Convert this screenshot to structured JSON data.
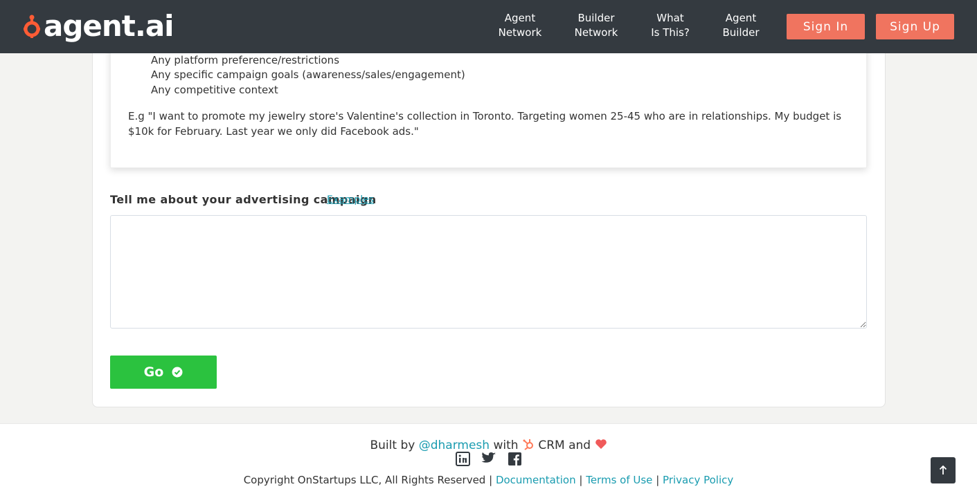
{
  "header": {
    "logo_text": "agent.ai",
    "nav": [
      {
        "line1": "Agent",
        "line2": "Network"
      },
      {
        "line1": "Builder",
        "line2": "Network"
      },
      {
        "line1": "What",
        "line2": "Is This?"
      },
      {
        "line1": "Agent",
        "line2": "Builder"
      }
    ],
    "sign_in": "Sign In",
    "sign_up": "Sign Up"
  },
  "description": {
    "bullets": [
      "Any platform preference/restrictions",
      "Any specific campaign goals (awareness/sales/engagement)",
      "Any competitive context"
    ],
    "example": "E.g \"I want to promote my jewelry store's Valentine's collection in Toronto. Targeting women 25-45 who are in relationships. My budget is $10k for February. Last year we only did Facebook ads.\""
  },
  "form": {
    "label": "Tell me about your advertising campaign",
    "examples_link": "Examples",
    "input_value": "",
    "go_label": "Go"
  },
  "footer": {
    "built_by": "Built by",
    "author": "@dharmesh",
    "with": "with",
    "crm": "CRM",
    "and": "and",
    "copyright": "Copyright OnStartups LLC, All Rights Reserved",
    "links": [
      "Documentation",
      "Terms of Use",
      "Privacy Policy"
    ],
    "separator": "|"
  },
  "colors": {
    "navbar": "#343a40",
    "auth_button": "#f0745f",
    "go_button": "#2bc23f",
    "link": "#1a9cb0",
    "heart": "#f05a5a",
    "hubspot": "#ff7a59"
  },
  "icons": [
    "agent-ai-logo-icon",
    "check-circle-icon",
    "hubspot-sprocket-icon",
    "heart-icon",
    "linkedin-icon",
    "twitter-icon",
    "facebook-icon",
    "arrow-up-icon"
  ]
}
